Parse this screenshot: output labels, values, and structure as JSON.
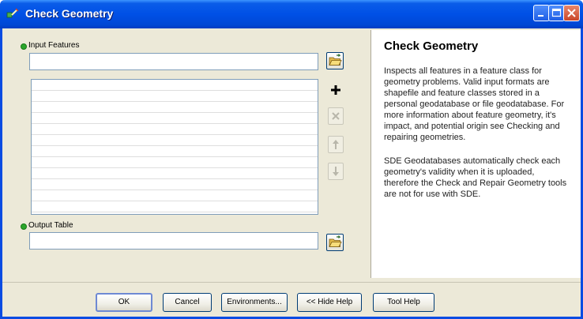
{
  "window": {
    "title": "Check Geometry",
    "controls": [
      "minimize",
      "maximize",
      "close"
    ]
  },
  "form": {
    "input_features_label": "Input Features",
    "input_features_value": "",
    "output_table_label": "Output Table",
    "output_table_value": "",
    "list_items": []
  },
  "help": {
    "title": "Check Geometry",
    "paragraphs": [
      "Inspects all features in a feature class for geometry problems. Valid input formats are shapefile and feature classes stored in a personal geodatabase or file geodatabase. For more information about feature geometry, it's impact, and potential origin see Checking and repairing geometries.",
      "SDE Geodatabases automatically check each geometry's validity when it is uploaded, therefore the Check and Repair Geometry tools are not for use with SDE."
    ]
  },
  "buttons": {
    "ok": "OK",
    "cancel": "Cancel",
    "environments": "Environments...",
    "hide_help": "<< Hide Help",
    "tool_help": "Tool Help"
  },
  "icons": {
    "browse": "folder-open-icon",
    "add": "plus-icon",
    "remove": "x-icon",
    "up": "arrow-up-icon",
    "down": "arrow-down-icon",
    "required": "green-dot-icon"
  },
  "colors": {
    "titlebar": "#0050e6",
    "dialog_bg": "#ece9d8",
    "required_dot": "#2ca62c"
  }
}
